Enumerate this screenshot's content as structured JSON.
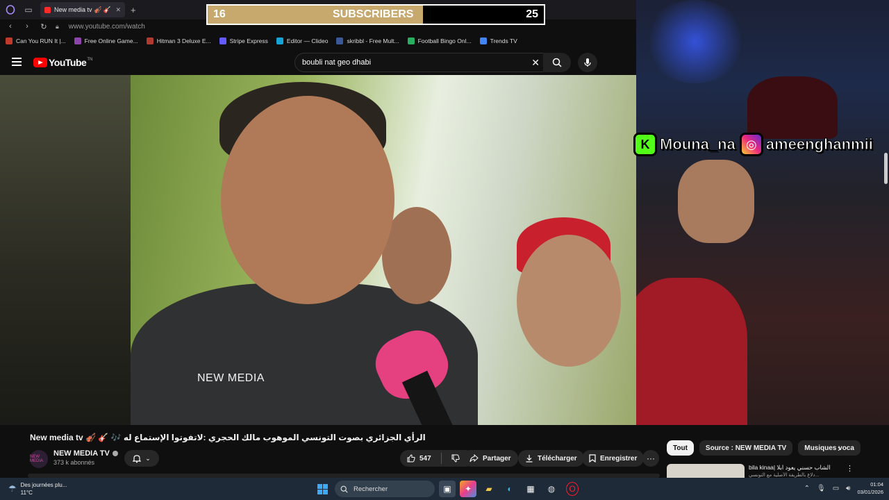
{
  "browser": {
    "tab_title": "New media tv 🎻 🎸 🎶 ما...",
    "url": "www.youtube.com/watch",
    "bookmarks": [
      {
        "label": "Can You RUN It |...",
        "color": "#c0392b"
      },
      {
        "label": "Free Online Game...",
        "color": "#8e44ad"
      },
      {
        "label": "Hitman 3 Deluxe E...",
        "color": "#b03a2e"
      },
      {
        "label": "Stripe Express",
        "color": "#635bff"
      },
      {
        "label": "Editor — Clideo",
        "color": "#16a3d6"
      },
      {
        "label": "skribbl - Free Mult...",
        "color": "#3b5998"
      },
      {
        "label": "Football Bingo Onl...",
        "color": "#27ae60"
      },
      {
        "label": "Trends TV",
        "color": "#4285f4"
      }
    ]
  },
  "youtube": {
    "logo_text": "YouTube",
    "logo_tm": "TN",
    "search_value": "boubli nat geo dhabi"
  },
  "overlay": {
    "sub_current": "16",
    "sub_label": "SUBSCRIBERS",
    "sub_goal": "25",
    "sub_progress": 0.64,
    "kick_handle": "Mouna_na",
    "instagram_handle": "ameenghanmii"
  },
  "video": {
    "watermark": "NEW MEDIA",
    "title": "New media tv 🎻 🎸 🎶 الرأي الجزائري بصوت التونسي الموهوب مالك الحجري :لاتفوتوا الإستماع له",
    "channel_name": "NEW MEDIA TV",
    "channel_avatar_text": "NEW MEDIA",
    "subscribers": "373 k abonnés",
    "likes": "547",
    "share_label": "Partager",
    "download_label": "Télécharger",
    "save_label": "Enregistrer",
    "more_label": "···"
  },
  "sidebar": {
    "chips": [
      "Tout",
      "Source : NEW MEDIA TV",
      "Musiques voca"
    ],
    "reco_title": "bila kinaa| الشاب حسني يعود ابلا",
    "reco_sub": "دلاع بالطريقة الأصلية مع التونسي..."
  },
  "taskbar": {
    "weather_text": "Des journées plu...",
    "temperature": "11°C",
    "search_label": "Rechercher",
    "time": "01:04",
    "date": "03/01/2026"
  }
}
